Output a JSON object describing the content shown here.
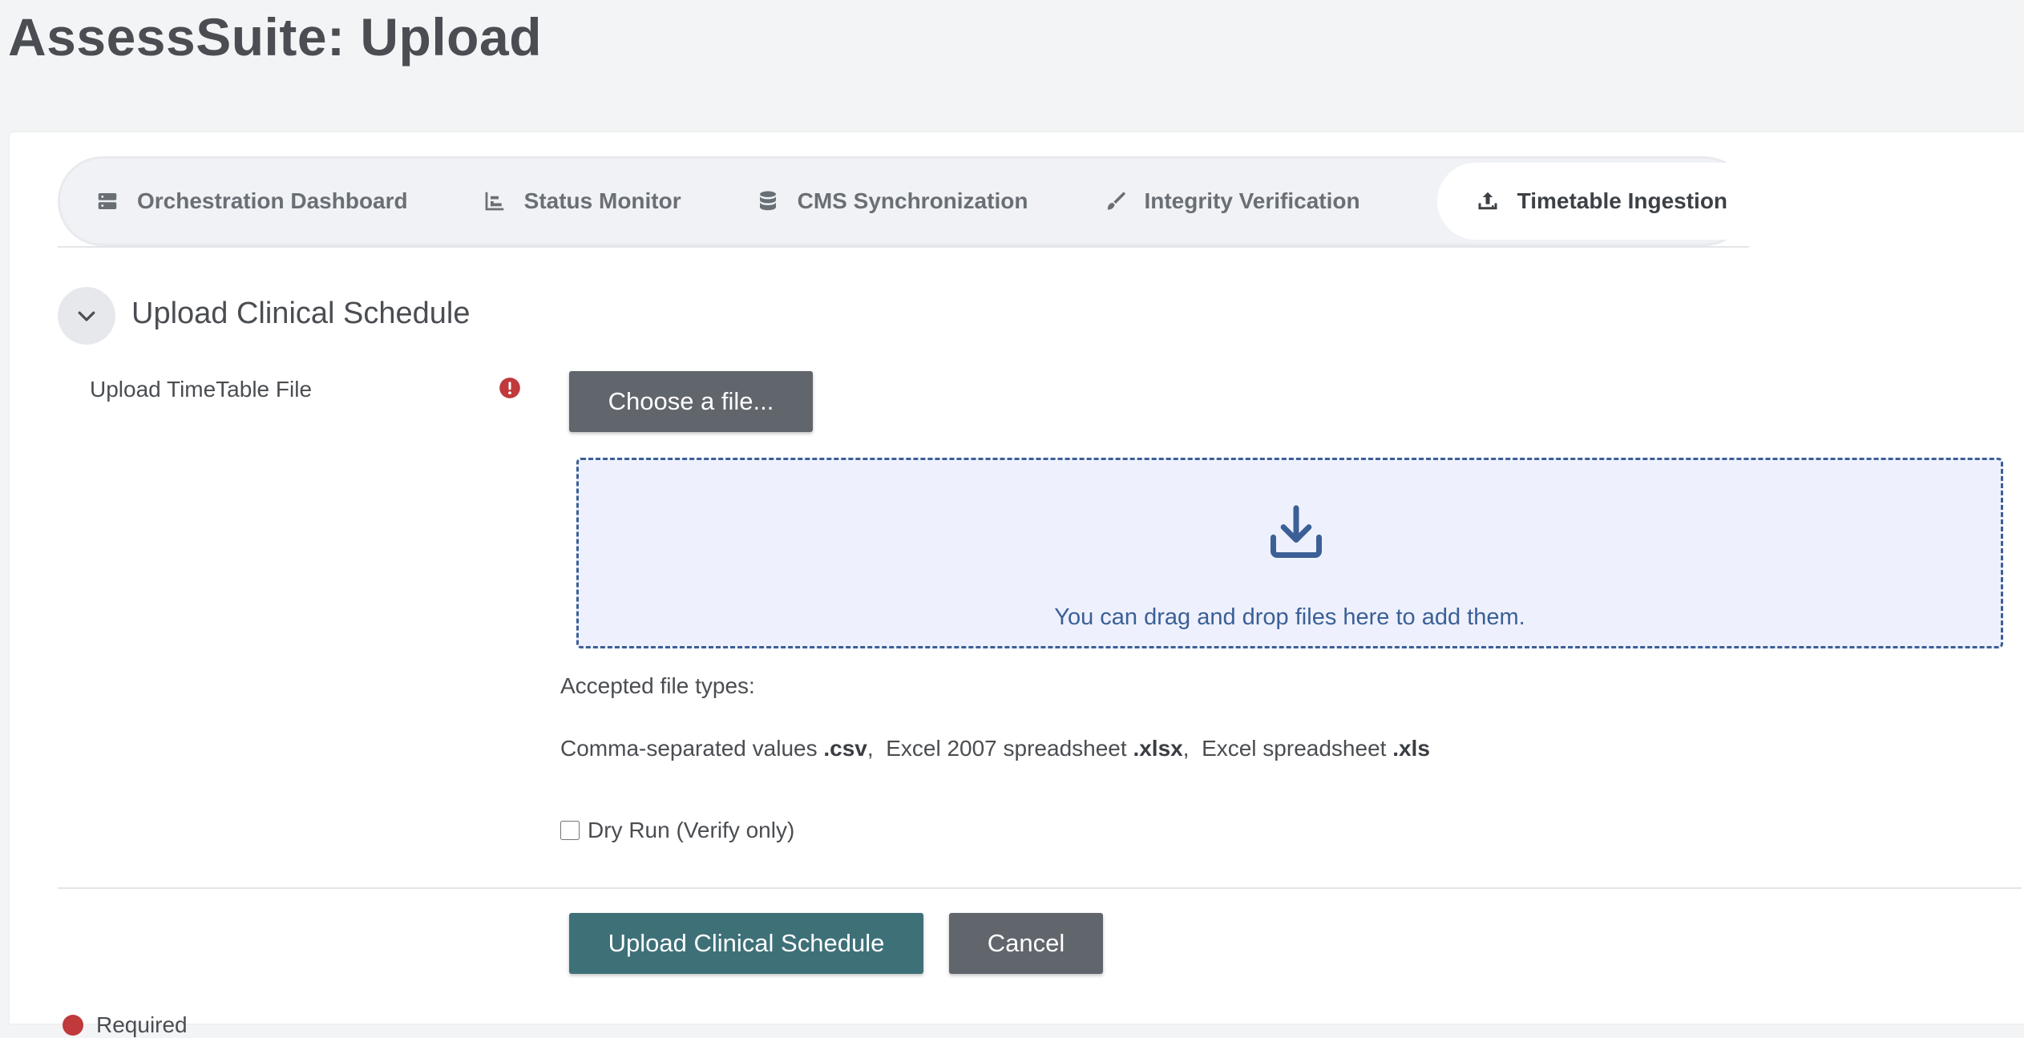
{
  "page": {
    "title": "AssessSuite: Upload"
  },
  "tabs": [
    {
      "label": "Orchestration Dashboard",
      "icon": "server-icon",
      "active": false
    },
    {
      "label": "Status Monitor",
      "icon": "bar-chart-icon",
      "active": false
    },
    {
      "label": "CMS Synchronization",
      "icon": "database-icon",
      "active": false
    },
    {
      "label": "Integrity Verification",
      "icon": "brush-icon",
      "active": false
    },
    {
      "label": "Timetable Ingestion",
      "icon": "upload-icon",
      "active": true
    }
  ],
  "section": {
    "title": "Upload Clinical Schedule",
    "toggle_icon": "chevron-down-icon"
  },
  "upload_field": {
    "label": "Upload TimeTable File",
    "required_icon": "exclamation-circle-icon",
    "choose_button": "Choose a file...",
    "dropzone_icon": "download-icon",
    "dropzone_text": "You can drag and drop files here to add them.",
    "accepted_label": "Accepted file types:",
    "accepted_types": [
      {
        "name": "Comma-separated values",
        "ext": ".csv"
      },
      {
        "name": "Excel 2007 spreadsheet",
        "ext": ".xlsx"
      },
      {
        "name": "Excel spreadsheet",
        "ext": ".xls"
      }
    ]
  },
  "dry_run": {
    "label": "Dry Run (Verify only)",
    "checked": false
  },
  "actions": {
    "submit_label": "Upload Clinical Schedule",
    "cancel_label": "Cancel"
  },
  "legend": {
    "required_label": "Required"
  },
  "colors": {
    "primary": "#3e7078",
    "secondary": "#61656c",
    "dropzone_accent": "#3b5f96",
    "dropzone_bg": "#eef1fd",
    "required": "#c0393b"
  }
}
